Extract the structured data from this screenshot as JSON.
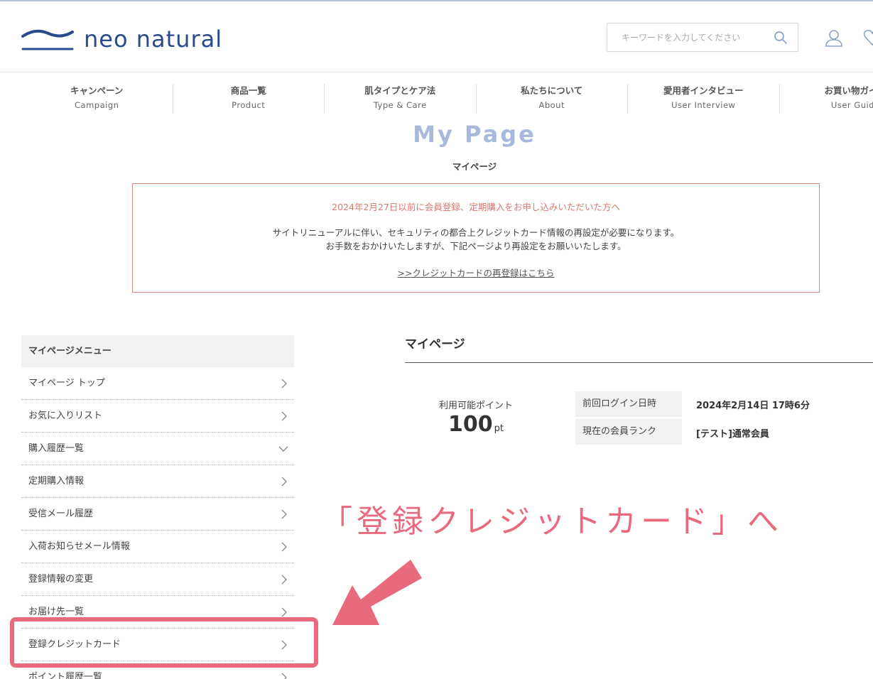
{
  "brand": {
    "name": "neo natural",
    "color": "#2b4a8b"
  },
  "search": {
    "placeholder": "キーワードを入力してください"
  },
  "nav": [
    {
      "jp": "キャンペーン",
      "en": "Campaign"
    },
    {
      "jp": "商品一覧",
      "en": "Product"
    },
    {
      "jp": "肌タイプとケア法",
      "en": "Type & Care"
    },
    {
      "jp": "私たちについて",
      "en": "About"
    },
    {
      "jp": "愛用者インタビュー",
      "en": "User Interview"
    },
    {
      "jp": "お買い物ガイド",
      "en": "User Guide"
    }
  ],
  "page": {
    "title": "My Page",
    "subtitle": "マイページ"
  },
  "notice": {
    "heading": "2024年2月27日以前に会員登録、定期購入をお申し込みいただいた方へ",
    "line1": "サイトリニューアルに伴い、セキュリティの都合上クレジットカード情報の再設定が必要になります。",
    "line2": "お手数をおかけいたしますが、下記ページより再設定をお願いいたします。",
    "link": ">>クレジットカードの再登録はこちら"
  },
  "sidemenu": {
    "heading": "マイページメニュー",
    "items": [
      {
        "label": "マイページ トップ"
      },
      {
        "label": "お気に入りリスト"
      },
      {
        "label": "購入履歴一覧"
      },
      {
        "label": "定期購入情報"
      },
      {
        "label": "受信メール履歴"
      },
      {
        "label": "入荷お知らせメール情報"
      },
      {
        "label": "登録情報の変更"
      },
      {
        "label": "お届け先一覧"
      },
      {
        "label": "登録クレジットカード"
      },
      {
        "label": "ポイント履歴一覧"
      }
    ]
  },
  "main": {
    "title": "マイページ",
    "points_label": "利用可能ポイント",
    "points_value": "100",
    "points_unit": "pt",
    "last_login_label": "前回ログイン日時",
    "last_login_value": "2024年2月14日 17時6分",
    "rank_label": "現在の会員ランク",
    "rank_value": "[テスト]通常会員"
  },
  "annotation": {
    "text": "「登録クレジットカード」へ",
    "color": "#ea6a7d"
  }
}
